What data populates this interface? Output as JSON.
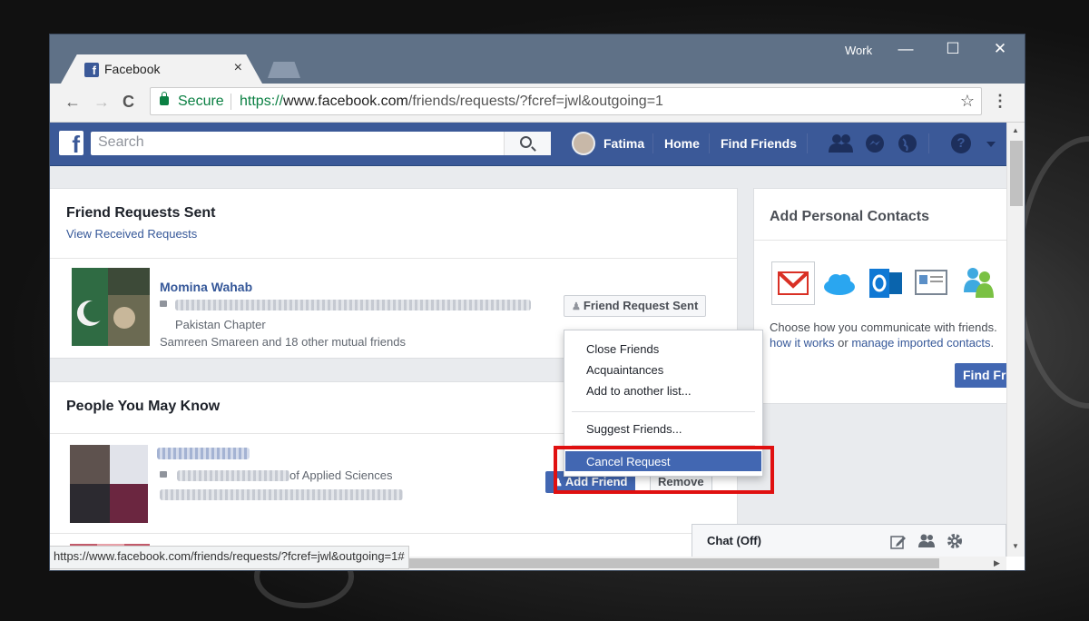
{
  "window": {
    "tab_title": "Facebook",
    "tab_close": "×",
    "profile_label": "Work",
    "minimize": "—",
    "maximize": "☐",
    "close": "✕"
  },
  "addressbar": {
    "back": "←",
    "forward": "→",
    "reload": "C",
    "secure_label": "Secure",
    "url_scheme": "https://",
    "url_host": "www.facebook.com",
    "url_path": "/friends/requests/?fcref=jwl&outgoing=1",
    "star": "☆",
    "menu": "⋮"
  },
  "fb_header": {
    "logo": "f",
    "search_placeholder": "Search",
    "user_name": "Fatima",
    "home": "Home",
    "find_friends": "Find Friends",
    "help": "?"
  },
  "requests_sent": {
    "title": "Friend Requests Sent",
    "view_received": "View Received Requests",
    "person": {
      "name": "Momina Wahab",
      "org_suffix": "Pakistan Chapter",
      "mutual": "Samreen Smareen and 18 other mutual friends",
      "button": "Friend Request Sent"
    }
  },
  "dropdown": {
    "items": [
      "Close Friends",
      "Acquaintances",
      "Add to another list..."
    ],
    "suggest": "Suggest Friends...",
    "cancel": "Cancel Request"
  },
  "people_you_may_know": {
    "title": "People You May Know",
    "person": {
      "org_suffix": "of Applied Sciences",
      "add_button": "Add Friend",
      "remove_button": "Remove"
    }
  },
  "contacts": {
    "title": "Add Personal Contacts",
    "text": "Choose how you communicate with friends.",
    "how_it_works": "how it works",
    "or": "or",
    "manage": "manage imported contacts",
    "period": ".",
    "find_button": "Find Fr"
  },
  "chat": {
    "label": "Chat (Off)"
  },
  "status": {
    "url": "https://www.facebook.com/friends/requests/?fcref=jwl&outgoing=1#"
  }
}
